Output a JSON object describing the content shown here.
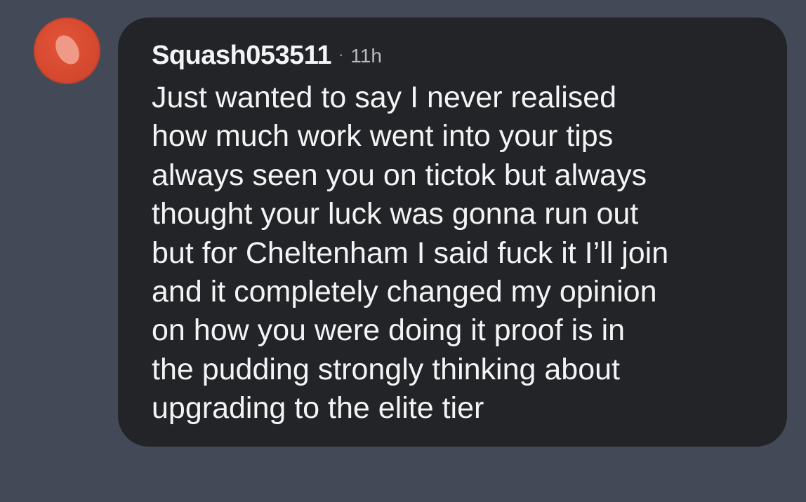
{
  "comment": {
    "username": "Squash053511",
    "separator": "·",
    "timestamp": "11h",
    "lines": [
      "Just wanted to say I never realised",
      "how much work went into your tips",
      "always seen you on tictok but always",
      "thought your luck was gonna run out",
      "but for Cheltenham I said fuck it I’ll join",
      "and it completely changed my opinion",
      "on how you were doing it proof is in",
      "the pudding strongly thinking about",
      "upgrading to the elite tier"
    ]
  },
  "colors": {
    "background": "#434957",
    "bubble": "#222427",
    "avatar": "#d74a30",
    "avatar_mark": "#ef9a87",
    "text": "#f4f4f5",
    "secondary_text": "#b7bbc1"
  },
  "icons": {
    "avatar": "user-avatar-icon"
  }
}
